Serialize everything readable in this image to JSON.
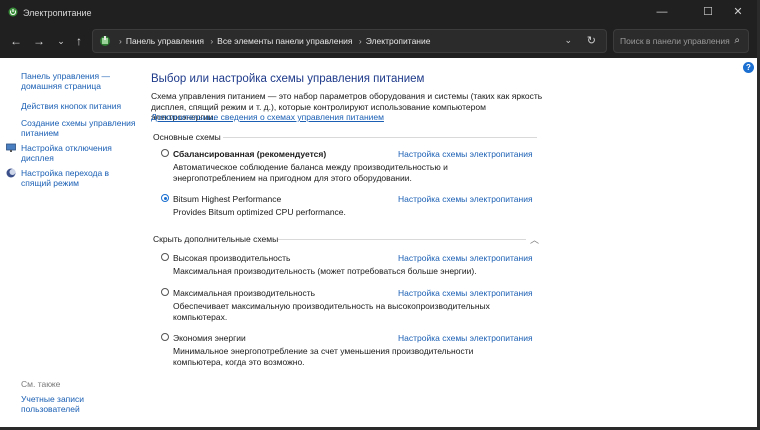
{
  "window": {
    "title": "Электропитание",
    "controls": {
      "minimize": "—",
      "maximize": "☐",
      "close": "✕"
    }
  },
  "nav": {
    "back": "←",
    "forward": "→",
    "recent": "⌄",
    "up": "↑"
  },
  "address": {
    "crumbs": [
      "Панель управления",
      "Все элементы панели управления",
      "Электропитание"
    ],
    "dropdown": "⌄",
    "refresh": "↻"
  },
  "search": {
    "placeholder": "Поиск в панели управления",
    "icon": "search-icon"
  },
  "sidebar": {
    "home_link": "Панель управления — домашняя страница",
    "items": [
      {
        "label": "Действия кнопок питания",
        "icon": null
      },
      {
        "label": "Создание схемы управления питанием",
        "icon": null
      },
      {
        "label": "Настройка отключения дисплея",
        "icon": "monitor-icon"
      },
      {
        "label": "Настройка перехода в спящий режим",
        "icon": "moon-icon"
      }
    ],
    "see_also_label": "См. также",
    "see_also_items": [
      "Учетные записи пользователей"
    ]
  },
  "main": {
    "title": "Выбор или настройка схемы управления питанием",
    "intro": "Схема управления питанием — это набор параметров оборудования и системы (таких как яркость дисплея, спящий режим и т. д.), которые контролируют использование компьютером электроэнергии.",
    "intro_link": "Дополнительные сведения о схемах управления питанием",
    "preferred_group_label": "Основные схемы",
    "hidden_group_label": "Скрыть дополнительные схемы",
    "plans_preferred": [
      {
        "name": "Сбалансированная (рекомендуется)",
        "bold": true,
        "selected": false,
        "link": "Настройка схемы электропитания",
        "desc": "Автоматическое соблюдение баланса между производительностью и энергопотреблением на пригодном для этого оборудовании."
      },
      {
        "name": "Bitsum Highest Performance",
        "bold": false,
        "selected": true,
        "link": "Настройка схемы электропитания",
        "desc": "Provides Bitsum optimized CPU performance."
      }
    ],
    "plans_hidden": [
      {
        "name": "Высокая производительность",
        "selected": false,
        "link": "Настройка схемы электропитания",
        "desc": "Максимальная производительность (может потребоваться больше энергии)."
      },
      {
        "name": "Максимальная производительность",
        "selected": false,
        "link": "Настройка схемы электропитания",
        "desc": "Обеспечивает максимальную производительность на высокопроизводительных компьютерах."
      },
      {
        "name": "Экономия энергии",
        "selected": false,
        "link": "Настройка схемы электропитания",
        "desc": "Минимальное энергопотребление за счет уменьшения производительности компьютера, когда это возможно."
      }
    ]
  },
  "colors": {
    "accent": "#1a6fd1",
    "link": "#1a5fb4",
    "title": "#1e3a8a",
    "titlebar": "#202020"
  }
}
